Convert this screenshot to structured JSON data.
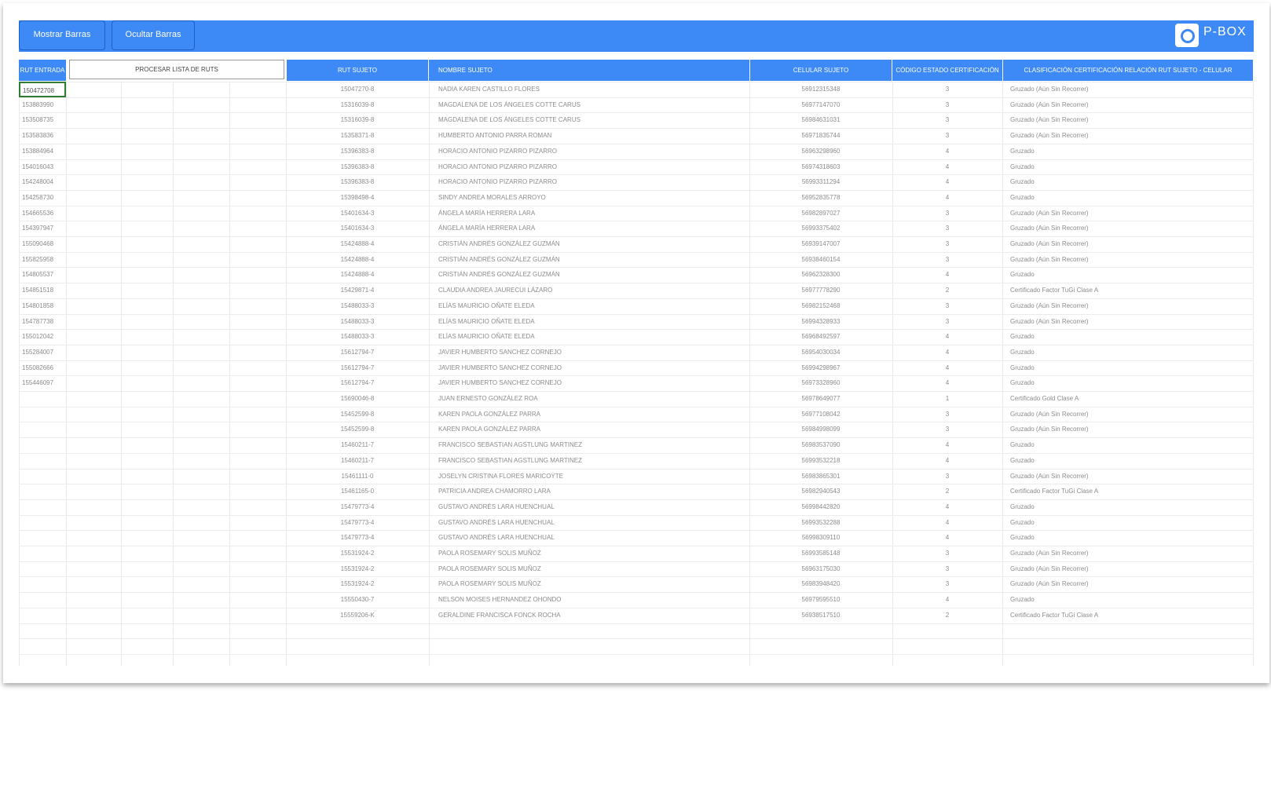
{
  "toolbar": {
    "show_bars_label": "Mostrar Barras",
    "hide_bars_label": "Ocultar Barras",
    "logo_text": "P-BOX"
  },
  "process_button_label": "PROCESAR LISTA DE RUTS",
  "headers": {
    "rut_entrada": "RUT ENTRADA",
    "rut_sujeto": "RUT SUJETO",
    "nombre_sujeto": "NOMBRE SUJETO",
    "celular_sujeto": "CELULAR SUJETO",
    "codigo_estado": "CÓDIGO ESTADO CERTIFICACIÓN",
    "clasificacion": "CLASIFICACIÓN CERTIFICACIÓN RELACIÓN RUT SUJETO - CELULAR"
  },
  "rut_entries": [
    "150472708",
    "153883990",
    "153508735",
    "153583836",
    "153884964",
    "154016043",
    "154248004",
    "154258730",
    "154665536",
    "154397947",
    "155090468",
    "155825958",
    "154805537",
    "154851518",
    "154801858",
    "154787738",
    "155012042",
    "155284007",
    "155082666",
    "155446097"
  ],
  "rows": [
    {
      "rut": "15047270-8",
      "name": "NADIA KAREN CASTILLO FLORES",
      "cel": "56912315348",
      "code": "3",
      "cls": "Gruzado (Aún Sin Recorrer)"
    },
    {
      "rut": "15316039-8",
      "name": "MAGDALENA DE LOS ÁNGELES COTTE CARUS",
      "cel": "56977147070",
      "code": "3",
      "cls": "Gruzado (Aún Sin Recorrer)"
    },
    {
      "rut": "15316039-8",
      "name": "MAGDALENA DE LOS ÁNGELES COTTE CARUS",
      "cel": "56984631031",
      "code": "3",
      "cls": "Gruzado (Aún Sin Recorrer)"
    },
    {
      "rut": "15358371-8",
      "name": "HUMBERTO ANTONIO PARRA ROMAN",
      "cel": "56971835744",
      "code": "3",
      "cls": "Gruzado (Aún Sin Recorrer)"
    },
    {
      "rut": "15396383-8",
      "name": "HORACIO ANTONIO PIZARRO PIZARRO",
      "cel": "56963298960",
      "code": "4",
      "cls": "Gruzado"
    },
    {
      "rut": "15396383-8",
      "name": "HORACIO ANTONIO PIZARRO PIZARRO",
      "cel": "56974318603",
      "code": "4",
      "cls": "Gruzado"
    },
    {
      "rut": "15396383-8",
      "name": "HORACIO ANTONIO PIZARRO PIZARRO",
      "cel": "56993311294",
      "code": "4",
      "cls": "Gruzado"
    },
    {
      "rut": "15398498-4",
      "name": "SINDY ANDREA MORALES ARROYO",
      "cel": "56952835778",
      "code": "4",
      "cls": "Gruzado"
    },
    {
      "rut": "15401634-3",
      "name": "ÁNGELA MARÍA HERRERA LARA",
      "cel": "56982897027",
      "code": "3",
      "cls": "Gruzado (Aún Sin Recorrer)"
    },
    {
      "rut": "15401634-3",
      "name": "ÁNGELA MARÍA HERRERA LARA",
      "cel": "56993375402",
      "code": "3",
      "cls": "Gruzado (Aún Sin Recorrer)"
    },
    {
      "rut": "15424888-4",
      "name": "CRISTIÁN ANDRÉS GONZÁLEZ GUZMÁN",
      "cel": "56939147007",
      "code": "3",
      "cls": "Gruzado (Aún Sin Recorrer)"
    },
    {
      "rut": "15424888-4",
      "name": "CRISTIÁN ANDRÉS GONZÁLEZ GUZMÁN",
      "cel": "56938460154",
      "code": "3",
      "cls": "Gruzado (Aún Sin Recorrer)"
    },
    {
      "rut": "15424888-4",
      "name": "CRISTIÁN ANDRÉS GONZÁLEZ GUZMÁN",
      "cel": "56962328300",
      "code": "4",
      "cls": "Gruzado"
    },
    {
      "rut": "15429871-4",
      "name": "CLAUDIA ANDREA JAURECUI LÁZARO",
      "cel": "56977778290",
      "code": "2",
      "cls": "Certificado Factor TuGi Clase A"
    },
    {
      "rut": "15488033-3",
      "name": "ELÍAS MAURICIO OÑATE ELEDA",
      "cel": "56982152468",
      "code": "3",
      "cls": "Gruzado (Aún Sin Recorrer)"
    },
    {
      "rut": "15488033-3",
      "name": "ELÍAS MAURICIO OÑATE ELEDA",
      "cel": "56994328933",
      "code": "3",
      "cls": "Gruzado (Aún Sin Recorrer)"
    },
    {
      "rut": "15488033-3",
      "name": "ELÍAS MAURICIO OÑATE ELEDA",
      "cel": "56968492597",
      "code": "4",
      "cls": "Gruzado"
    },
    {
      "rut": "15612794-7",
      "name": "JAVIER HUMBERTO SANCHEZ CORNEJO",
      "cel": "56954030034",
      "code": "4",
      "cls": "Gruzado"
    },
    {
      "rut": "15612794-7",
      "name": "JAVIER HUMBERTO SANCHEZ CORNEJO",
      "cel": "56994298967",
      "code": "4",
      "cls": "Gruzado"
    },
    {
      "rut": "15612794-7",
      "name": "JAVIER HUMBERTO SANCHEZ CORNEJO",
      "cel": "56973328960",
      "code": "4",
      "cls": "Gruzado"
    },
    {
      "rut": "15690046-8",
      "name": "JUAN ERNESTO GONZÁLEZ ROA",
      "cel": "56978649077",
      "code": "1",
      "cls": "Certificado Gold Clase A"
    },
    {
      "rut": "15452599-8",
      "name": "KAREN PAOLA GONZÁLEZ PARRA",
      "cel": "56977108042",
      "code": "3",
      "cls": "Gruzado (Aún Sin Recorrer)"
    },
    {
      "rut": "15452599-8",
      "name": "KAREN PAOLA GONZÁLEZ PARRA",
      "cel": "56984998099",
      "code": "3",
      "cls": "Gruzado (Aún Sin Recorrer)"
    },
    {
      "rut": "15460211-7",
      "name": "FRANCISCO SEBASTIAN AGSTLUNG MARTINEZ",
      "cel": "56983537090",
      "code": "4",
      "cls": "Gruzado"
    },
    {
      "rut": "15460211-7",
      "name": "FRANCISCO SEBASTIAN AGSTLUNG MARTINEZ",
      "cel": "56993532218",
      "code": "4",
      "cls": "Gruzado"
    },
    {
      "rut": "15461111-0",
      "name": "JOSELYN CRISTINA FLORES MARICOYTE",
      "cel": "56983865301",
      "code": "3",
      "cls": "Gruzado (Aún Sin Recorrer)"
    },
    {
      "rut": "15461165-0",
      "name": "PATRICIA ANDREA CHAMORRO LARA",
      "cel": "56982940543",
      "code": "2",
      "cls": "Certificado Factor TuGi Clase A"
    },
    {
      "rut": "15479773-4",
      "name": "GUSTAVO ANDRÉS LARA HUENCHUAL",
      "cel": "56998442820",
      "code": "4",
      "cls": "Gruzado"
    },
    {
      "rut": "15479773-4",
      "name": "GUSTAVO ANDRÉS LARA HUENCHUAL",
      "cel": "56993532288",
      "code": "4",
      "cls": "Gruzado"
    },
    {
      "rut": "15479773-4",
      "name": "GUSTAVO ANDRÉS LARA HUENCHUAL",
      "cel": "56998309110",
      "code": "4",
      "cls": "Gruzado"
    },
    {
      "rut": "15531924-2",
      "name": "PAOLA ROSEMARY SOLIS MUÑOZ",
      "cel": "56993585148",
      "code": "3",
      "cls": "Gruzado (Aún Sin Recorrer)"
    },
    {
      "rut": "15531924-2",
      "name": "PAOLA ROSEMARY SOLIS MUÑOZ",
      "cel": "56963175030",
      "code": "3",
      "cls": "Gruzado (Aún Sin Recorrer)"
    },
    {
      "rut": "15531924-2",
      "name": "PAOLA ROSEMARY SOLIS MUÑOZ",
      "cel": "56983948420",
      "code": "3",
      "cls": "Gruzado (Aún Sin Recorrer)"
    },
    {
      "rut": "15550430-7",
      "name": "NELSON MOISES HERNANDEZ OHONDO",
      "cel": "56979595510",
      "code": "4",
      "cls": "Gruzado"
    },
    {
      "rut": "15559206-K",
      "name": "GERALDINE FRANCISCA FONCK ROCHA",
      "cel": "56938517510",
      "code": "2",
      "cls": "Certificado Factor TuGi Clase A"
    }
  ]
}
